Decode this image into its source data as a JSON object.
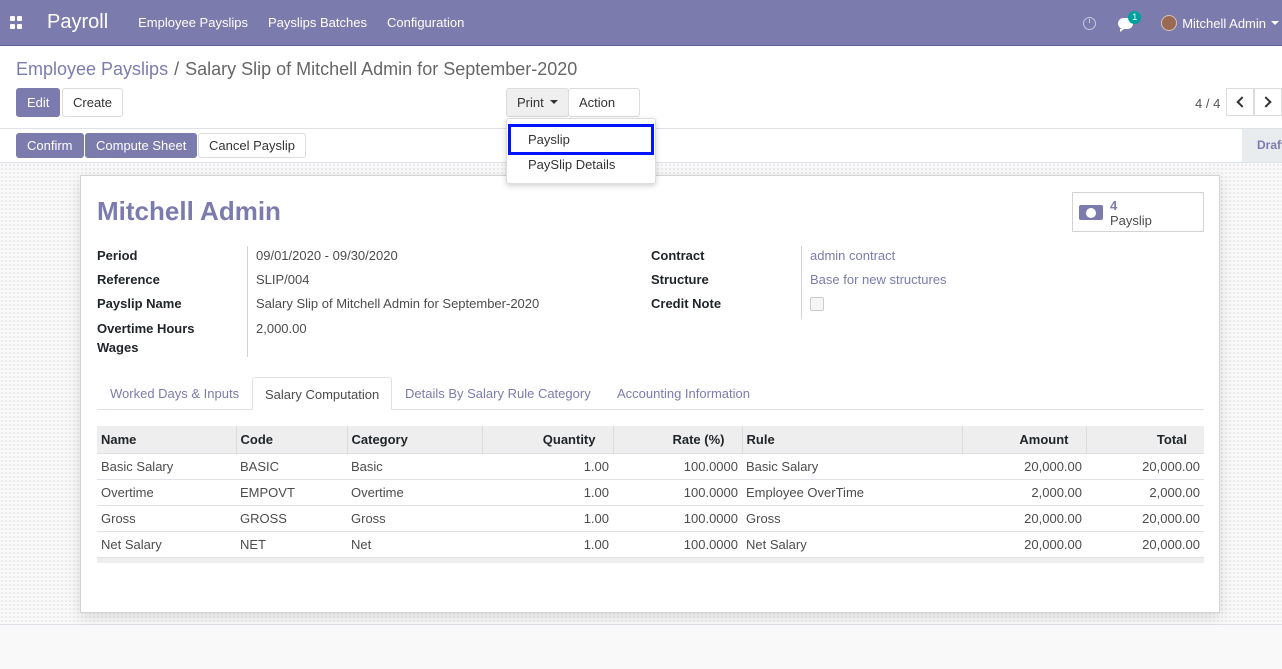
{
  "navbar": {
    "brand": "Payroll",
    "menu": [
      "Employee Payslips",
      "Payslips Batches",
      "Configuration"
    ],
    "chat_count": "1",
    "user": "Mitchell Admin"
  },
  "breadcrumb": {
    "parent": "Employee Payslips",
    "separator": "/",
    "current": "Salary Slip of Mitchell Admin for September-2020"
  },
  "actions": {
    "edit": "Edit",
    "create": "Create",
    "print": "Print",
    "action": "Action"
  },
  "print_menu": {
    "items": [
      "Payslip",
      "PaySlip Details"
    ],
    "highlighted": "Payslip"
  },
  "pager": {
    "value": "4 / 4"
  },
  "status_buttons": {
    "confirm": "Confirm",
    "compute": "Compute Sheet",
    "cancel": "Cancel Payslip"
  },
  "status_stage": "Draft",
  "form": {
    "employee": "Mitchell Admin",
    "smart_button": {
      "value": "4",
      "label": "Payslip",
      "icon": "money-icon"
    },
    "left_fields": [
      {
        "label": "Period",
        "value": "09/01/2020 - 09/30/2020"
      },
      {
        "label": "Reference",
        "value": "SLIP/004"
      },
      {
        "label": "Payslip Name",
        "value": "Salary Slip of Mitchell Admin for September-2020"
      },
      {
        "label": "Overtime Hours",
        "label2": "Wages",
        "value": "2,000.00"
      }
    ],
    "right_fields": [
      {
        "label": "Contract",
        "value": "admin contract"
      },
      {
        "label": "Structure",
        "value": "Base for new structures"
      },
      {
        "label": "Credit Note",
        "value": false
      }
    ]
  },
  "tabs": [
    {
      "label": "Worked Days & Inputs",
      "active": false
    },
    {
      "label": "Salary Computation",
      "active": true
    },
    {
      "label": "Details By Salary Rule Category",
      "active": false
    },
    {
      "label": "Accounting Information",
      "active": false
    }
  ],
  "table": {
    "columns": [
      "Name",
      "Code",
      "Category",
      "Quantity",
      "Rate (%)",
      "Rule",
      "Amount",
      "Total"
    ],
    "rows": [
      [
        "Basic Salary",
        "BASIC",
        "Basic",
        "1.00",
        "100.0000",
        "Basic Salary",
        "20,000.00",
        "20,000.00"
      ],
      [
        "Overtime",
        "EMPOVT",
        "Overtime",
        "1.00",
        "100.0000",
        "Employee OverTime",
        "2,000.00",
        "2,000.00"
      ],
      [
        "Gross",
        "GROSS",
        "Gross",
        "1.00",
        "100.0000",
        "Gross",
        "20,000.00",
        "20,000.00"
      ],
      [
        "Net Salary",
        "NET",
        "Net",
        "1.00",
        "100.0000",
        "Net Salary",
        "20,000.00",
        "20,000.00"
      ]
    ]
  },
  "colors": {
    "brand": "#7c7bad",
    "highlight_border": "#0014ff"
  }
}
